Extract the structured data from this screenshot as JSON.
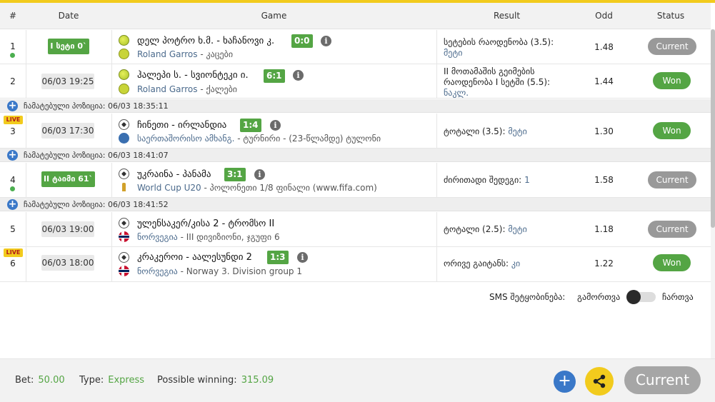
{
  "header": {
    "num": "#",
    "date": "Date",
    "game": "Game",
    "result": "Result",
    "odd": "Odd",
    "status": "Status"
  },
  "rows": [
    {
      "num": "1",
      "live": "",
      "date": "I სეტი 0`",
      "title": "დელ პოტრო ხ.მ. - ხაჩანოვი კ.",
      "score": "0:0",
      "league_link": "Roland Garros",
      "league_rest": " - კაცები",
      "result_text": "სეტების რაოდენობა (3.5):",
      "result_pick": "მეტი",
      "odd": "1.48",
      "status": "Current"
    },
    {
      "num": "2",
      "live": "",
      "date": "06/03 19:25",
      "title": "ჰალეპი ს. - სვიონტეკი ი.",
      "score": "6:1",
      "league_link": "Roland Garros",
      "league_rest": " - ქალები",
      "result_text": "II მოთამაშის გეიმების რაოდენობა I სეტში (5.5):",
      "result_pick": "ნაკლ.",
      "odd": "1.44",
      "status": "Won"
    },
    {
      "num": "3",
      "live": "LIVE",
      "date": "06/03 17:30",
      "title": "ჩინეთი - ირლანდია",
      "score": "1:4",
      "league_link": "საერთაშორისო ამხანგ.",
      "league_rest": " - ტურნირი - (23-წლამდე) ტულონი",
      "result_text": "ტოტალი (3.5):",
      "result_pick": "მეტი",
      "odd": "1.30",
      "status": "Won"
    },
    {
      "num": "4",
      "live": "",
      "date": "II ტაიმი 61`",
      "title": "უკრაინა - პანამა",
      "score": "3:1",
      "league_link": "World Cup U20",
      "league_rest": " - პოლონეთი 1/8 ფინალი (www.fifa.com)",
      "result_text": "ძირითადი შედეგი:",
      "result_pick": "1",
      "odd": "1.58",
      "status": "Current"
    },
    {
      "num": "5",
      "live": "",
      "date": "06/03 19:00",
      "title": "ულენსაკერ/კისა 2 - ტრომსო II",
      "score": "",
      "league_link": "ნორვეგია",
      "league_rest": " - III დივიზიონი, ჯგუფი 6",
      "result_text": "ტოტალი (2.5):",
      "result_pick": "მეტი",
      "odd": "1.18",
      "status": "Current"
    },
    {
      "num": "6",
      "live": "LIVE",
      "date": "06/03 18:00",
      "title": "კრაკეროი - აალესუნდი 2",
      "score": "1:3",
      "league_link": "ნორვეგია",
      "league_rest": " - Norway 3. Division group 1",
      "result_text": "ორივე გაიტანს:",
      "result_pick": "კი",
      "odd": "1.22",
      "status": "Won"
    }
  ],
  "separators": [
    {
      "label": "ჩამატებული პოზიცია:",
      "time": "06/03 18:35:11"
    },
    {
      "label": "ჩამატებული პოზიცია:",
      "time": "06/03 18:41:07"
    },
    {
      "label": "ჩამატებული პოზიცია:",
      "time": "06/03 18:41:52"
    }
  ],
  "sms": {
    "label": "SMS შეტყობინება:",
    "off": "გამორთვა",
    "on": "ჩართვა",
    "enabled": false
  },
  "footer": {
    "bet_label": "Bet:",
    "bet_value": "50.00",
    "type_label": "Type:",
    "type_value": "Express",
    "win_label": "Possible winning:",
    "win_value": "315.09",
    "current_label": "Current",
    "plus_glyph": "+"
  },
  "icons": {
    "info_glyph": "i",
    "plus_glyph": "+"
  },
  "colors": {
    "accent_yellow": "#f2cb1d",
    "won_green": "#54a544",
    "current_gray": "#999999",
    "link_blue": "#4b6a8c",
    "plus_blue": "#3a78c8"
  }
}
